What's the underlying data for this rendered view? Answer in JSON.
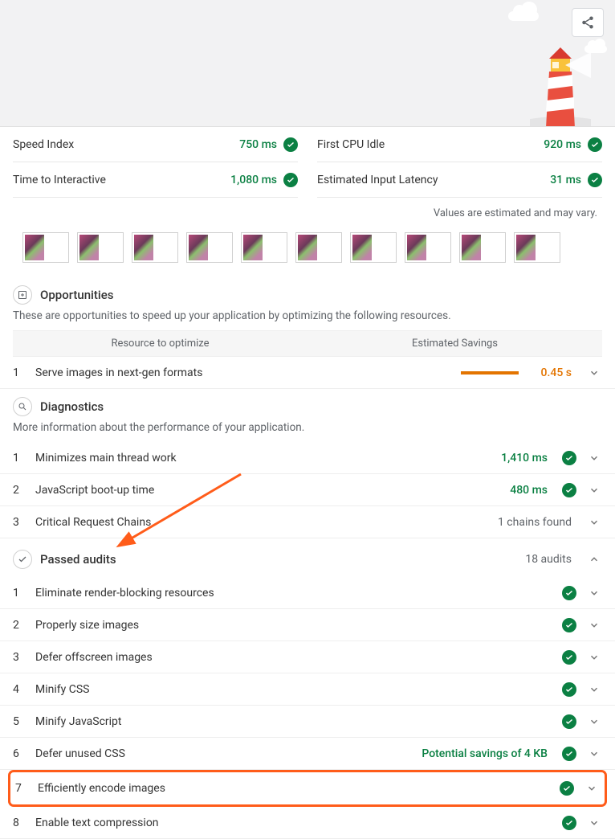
{
  "metrics_left": [
    {
      "label": "Speed Index",
      "value": "750 ms"
    },
    {
      "label": "Time to Interactive",
      "value": "1,080 ms"
    }
  ],
  "metrics_right": [
    {
      "label": "First CPU Idle",
      "value": "920 ms"
    },
    {
      "label": "Estimated Input Latency",
      "value": "31 ms"
    }
  ],
  "estimate_note": "Values are estimated and may vary.",
  "opportunities": {
    "title": "Opportunities",
    "desc": "These are opportunities to speed up your application by optimizing the following resources.",
    "col_resource": "Resource to optimize",
    "col_savings": "Estimated Savings",
    "items": [
      {
        "num": "1",
        "title": "Serve images in next-gen formats",
        "savings": "0.45 s"
      }
    ]
  },
  "diagnostics": {
    "title": "Diagnostics",
    "desc": "More information about the performance of your application.",
    "items": [
      {
        "num": "1",
        "title": "Minimizes main thread work",
        "value": "1,410 ms",
        "pass": true
      },
      {
        "num": "2",
        "title": "JavaScript boot-up time",
        "value": "480 ms",
        "pass": true
      },
      {
        "num": "3",
        "title": "Critical Request Chains",
        "note": "1 chains found"
      }
    ]
  },
  "passed": {
    "title": "Passed audits",
    "count": "18 audits",
    "items": [
      {
        "num": "1",
        "title": "Eliminate render-blocking resources"
      },
      {
        "num": "2",
        "title": "Properly size images"
      },
      {
        "num": "3",
        "title": "Defer offscreen images"
      },
      {
        "num": "4",
        "title": "Minify CSS"
      },
      {
        "num": "5",
        "title": "Minify JavaScript"
      },
      {
        "num": "6",
        "title": "Defer unused CSS",
        "value": "Potential savings of 4 KB"
      },
      {
        "num": "7",
        "title": "Efficiently encode images",
        "highlight": true
      },
      {
        "num": "8",
        "title": "Enable text compression"
      }
    ]
  }
}
